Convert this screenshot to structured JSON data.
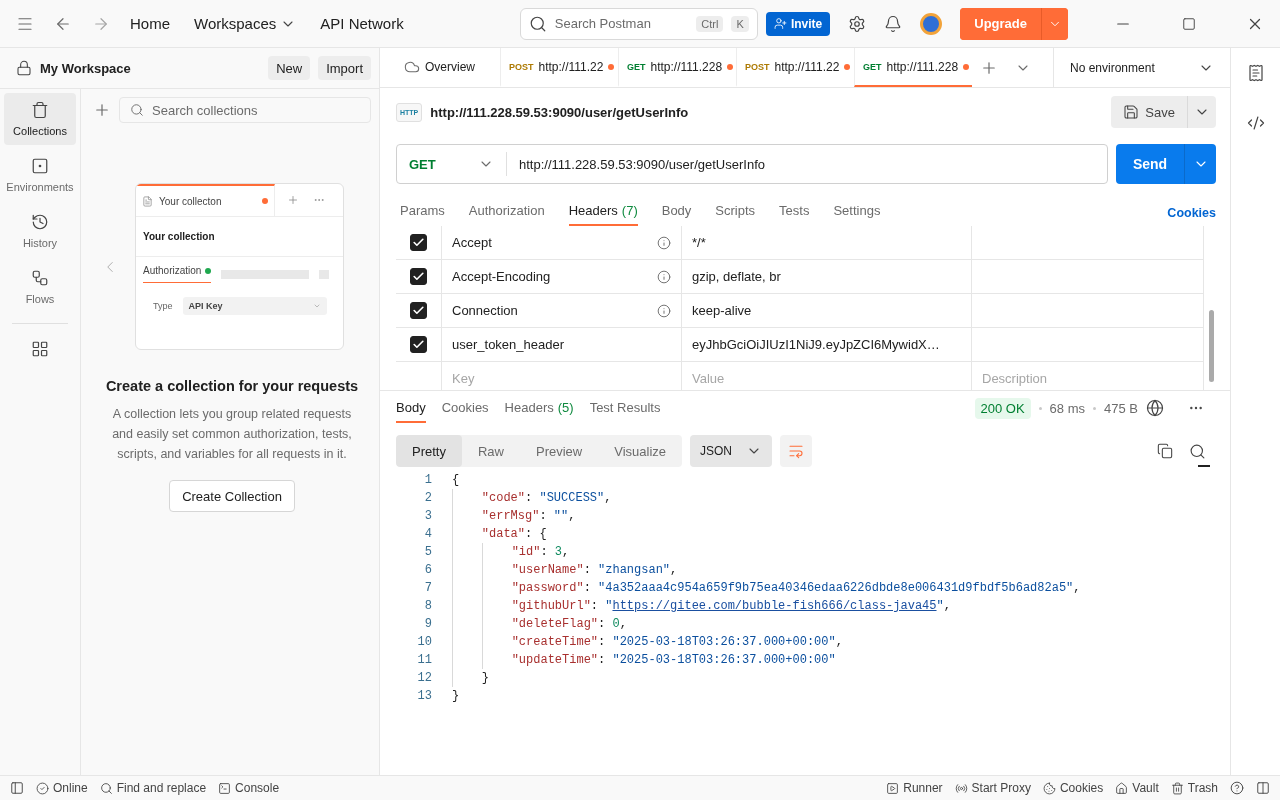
{
  "topbar": {
    "nav": [
      "Home",
      "Workspaces",
      "API Network"
    ],
    "search_placeholder": "Search Postman",
    "shortcut": [
      "Ctrl",
      "K"
    ],
    "invite": "Invite",
    "upgrade": "Upgrade"
  },
  "sidebar": {
    "workspace": "My Workspace",
    "buttons": [
      "New",
      "Import"
    ],
    "rail": [
      {
        "label": "Collections",
        "selected": true
      },
      {
        "label": "Environments",
        "selected": false
      },
      {
        "label": "History",
        "selected": false
      },
      {
        "label": "Flows",
        "selected": false
      }
    ],
    "search_placeholder": "Search collections",
    "illustration": {
      "tab_title": "Your collecton",
      "heading": "Your collection",
      "tab": "Authorization",
      "type_label": "Type",
      "type_value": "API Key"
    },
    "empty_title": "Create a collection for your requests",
    "empty_text": "A collection lets you group related requests and easily set common authorization, tests, scripts, and variables for all requests in it.",
    "create_button": "Create Collection"
  },
  "tabs": [
    {
      "kind": "overview",
      "label": "Overview",
      "selected": false
    },
    {
      "kind": "request",
      "method": "POST",
      "url": "http://111.22",
      "unsaved": true,
      "selected": false
    },
    {
      "kind": "request",
      "method": "GET",
      "url": "http://111.228",
      "unsaved": true,
      "selected": false
    },
    {
      "kind": "request",
      "method": "POST",
      "url": "http://111.22",
      "unsaved": true,
      "selected": false
    },
    {
      "kind": "request",
      "method": "GET",
      "url": "http://111.228",
      "unsaved": true,
      "selected": true
    }
  ],
  "environment": "No environment",
  "request": {
    "icon_text": "HTTP",
    "title": "http://111.228.59.53:9090/user/getUserInfo",
    "save": "Save",
    "method": "GET",
    "url": "http://111.228.59.53:9090/user/getUserInfo",
    "send": "Send",
    "subtabs": [
      {
        "label": "Params",
        "selected": false
      },
      {
        "label": "Authorization",
        "selected": false
      },
      {
        "label": "Headers",
        "count": "(7)",
        "selected": true
      },
      {
        "label": "Body",
        "selected": false
      },
      {
        "label": "Scripts",
        "selected": false
      },
      {
        "label": "Tests",
        "selected": false
      },
      {
        "label": "Settings",
        "selected": false
      }
    ],
    "cookies": "Cookies"
  },
  "headers": {
    "rows": [
      {
        "checked": true,
        "key": "Accept",
        "info": true,
        "value": "*/*"
      },
      {
        "checked": true,
        "key": "Accept-Encoding",
        "info": true,
        "value": "gzip, deflate, br"
      },
      {
        "checked": true,
        "key": "Connection",
        "info": true,
        "value": "keep-alive"
      },
      {
        "checked": true,
        "key": "user_token_header",
        "info": false,
        "value": "eyJhbGciOiJIUzI1NiJ9.eyJpZCI6MywidX…"
      }
    ],
    "new_row": {
      "key_placeholder": "Key",
      "value_placeholder": "Value",
      "description_placeholder": "Description"
    }
  },
  "response": {
    "tabs": [
      {
        "label": "Body",
        "selected": true
      },
      {
        "label": "Cookies",
        "selected": false
      },
      {
        "label": "Headers",
        "count": "(5)",
        "selected": false
      },
      {
        "label": "Test Results",
        "selected": false
      }
    ],
    "status": "200 OK",
    "time": "68 ms",
    "size": "475 B",
    "views": [
      {
        "label": "Pretty",
        "selected": true
      },
      {
        "label": "Raw",
        "selected": false
      },
      {
        "label": "Preview",
        "selected": false
      },
      {
        "label": "Visualize",
        "selected": false
      }
    ],
    "format": "JSON",
    "lines": [
      {
        "n": "1",
        "tokens": [
          {
            "kind": "punct",
            "text": "{"
          }
        ]
      },
      {
        "n": "2",
        "tokens": [
          {
            "kind": "key",
            "text": "    \"code\""
          },
          {
            "kind": "punct",
            "text": ": "
          },
          {
            "kind": "string",
            "text": "\"SUCCESS\""
          },
          {
            "kind": "punct",
            "text": ","
          }
        ]
      },
      {
        "n": "3",
        "tokens": [
          {
            "kind": "key",
            "text": "    \"errMsg\""
          },
          {
            "kind": "punct",
            "text": ": "
          },
          {
            "kind": "string",
            "text": "\"\""
          },
          {
            "kind": "punct",
            "text": ","
          }
        ]
      },
      {
        "n": "4",
        "tokens": [
          {
            "kind": "key",
            "text": "    \"data\""
          },
          {
            "kind": "punct",
            "text": ": {"
          }
        ]
      },
      {
        "n": "5",
        "tokens": [
          {
            "kind": "key",
            "text": "        \"id\""
          },
          {
            "kind": "punct",
            "text": ": "
          },
          {
            "kind": "number",
            "text": "3"
          },
          {
            "kind": "punct",
            "text": ","
          }
        ]
      },
      {
        "n": "6",
        "tokens": [
          {
            "kind": "key",
            "text": "        \"userName\""
          },
          {
            "kind": "punct",
            "text": ": "
          },
          {
            "kind": "string",
            "text": "\"zhangsan\""
          },
          {
            "kind": "punct",
            "text": ","
          }
        ]
      },
      {
        "n": "7",
        "tokens": [
          {
            "kind": "key",
            "text": "        \"password\""
          },
          {
            "kind": "punct",
            "text": ": "
          },
          {
            "kind": "string",
            "text": "\"4a352aaa4c954a659f9b75ea40346edaa6226dbde8e006431d9fbdf5b6ad82a5\""
          },
          {
            "kind": "punct",
            "text": ","
          }
        ]
      },
      {
        "n": "8",
        "tokens": [
          {
            "kind": "key",
            "text": "        \"githubUrl\""
          },
          {
            "kind": "punct",
            "text": ": "
          },
          {
            "kind": "string",
            "text": "\""
          },
          {
            "kind": "link",
            "text": "https://gitee.com/bubble-fish666/class-java45"
          },
          {
            "kind": "string",
            "text": "\""
          },
          {
            "kind": "punct",
            "text": ","
          }
        ]
      },
      {
        "n": "9",
        "tokens": [
          {
            "kind": "key",
            "text": "        \"deleteFlag\""
          },
          {
            "kind": "punct",
            "text": ": "
          },
          {
            "kind": "number",
            "text": "0"
          },
          {
            "kind": "punct",
            "text": ","
          }
        ]
      },
      {
        "n": "10",
        "tokens": [
          {
            "kind": "key",
            "text": "        \"createTime\""
          },
          {
            "kind": "punct",
            "text": ": "
          },
          {
            "kind": "string",
            "text": "\"2025-03-18T03:26:37.000+00:00\""
          },
          {
            "kind": "punct",
            "text": ","
          }
        ]
      },
      {
        "n": "11",
        "tokens": [
          {
            "kind": "key",
            "text": "        \"updateTime\""
          },
          {
            "kind": "punct",
            "text": ": "
          },
          {
            "kind": "string",
            "text": "\"2025-03-18T03:26:37.000+00:00\""
          }
        ]
      },
      {
        "n": "12",
        "tokens": [
          {
            "kind": "punct",
            "text": "    }"
          }
        ]
      },
      {
        "n": "13",
        "tokens": [
          {
            "kind": "punct",
            "text": "}"
          }
        ]
      }
    ]
  },
  "statusbar": {
    "left": [
      "Online",
      "Find and replace",
      "Console"
    ],
    "right": [
      "Runner",
      "Start Proxy",
      "Cookies",
      "Vault",
      "Trash"
    ]
  }
}
